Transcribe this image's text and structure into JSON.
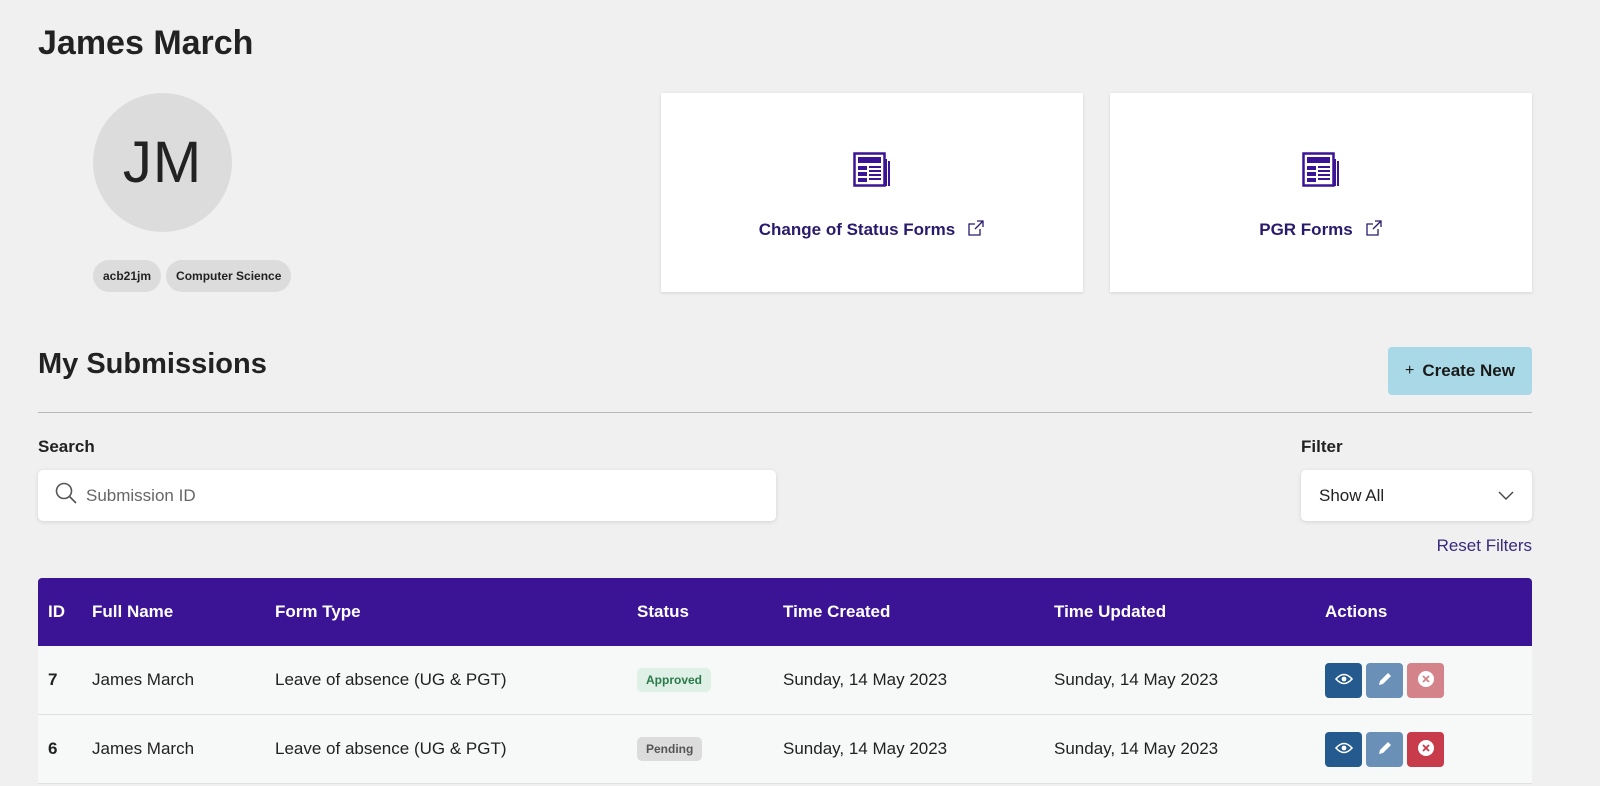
{
  "profile": {
    "name": "James March",
    "initials": "JM",
    "tags": [
      "acb21jm",
      "Computer Science"
    ]
  },
  "cards": [
    {
      "label": "Change of Status Forms",
      "icon": "forms-icon"
    },
    {
      "label": "PGR Forms",
      "icon": "forms-icon"
    }
  ],
  "submissions": {
    "title": "My Submissions",
    "create_label": "Create New",
    "create_icon": "+",
    "search_label": "Search",
    "search_placeholder": "Submission ID",
    "filter_label": "Filter",
    "filter_value": "Show All",
    "reset_label": "Reset Filters"
  },
  "table": {
    "headers": [
      "ID",
      "Full Name",
      "Form Type",
      "Status",
      "Time Created",
      "Time Updated",
      "Actions"
    ],
    "rows": [
      {
        "id": "7",
        "name": "James March",
        "type": "Leave of absence (UG & PGT)",
        "status": "Approved",
        "created": "Sunday, 14 May 2023",
        "updated": "Sunday, 14 May 2023"
      },
      {
        "id": "6",
        "name": "James March",
        "type": "Leave of absence (UG & PGT)",
        "status": "Pending",
        "created": "Sunday, 14 May 2023",
        "updated": "Sunday, 14 May 2023"
      }
    ]
  },
  "colors": {
    "brand_purple": "#3b1496",
    "create_button": "#a9d9e6",
    "view_button": "#245a8e",
    "edit_button": "#6a90b8",
    "delete_button": "#c73b4a"
  }
}
